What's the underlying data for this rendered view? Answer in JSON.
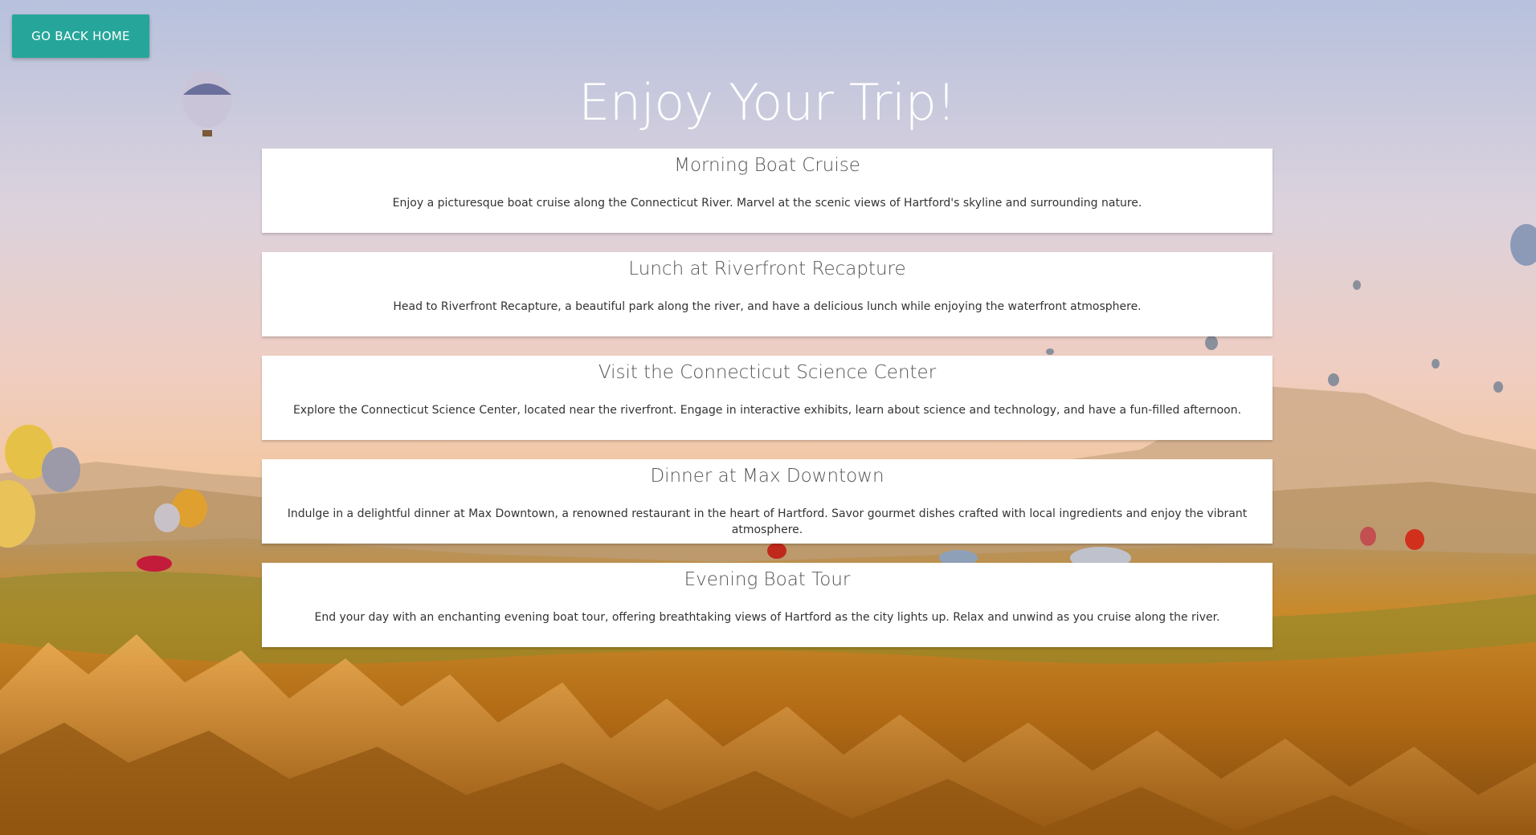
{
  "header": {
    "back_button_label": "GO BACK HOME",
    "title": "Enjoy Your Trip!"
  },
  "background": {
    "description_icon": "hot-air-balloons-landscape",
    "sky_top": "#b9c2dc",
    "sky_mid": "#ecccc6",
    "horizon": "#f3c38a",
    "land": "#b87a1f"
  },
  "theme": {
    "accent": "#26a69a"
  },
  "activities": [
    {
      "title": "Morning Boat Cruise",
      "description": "Enjoy a picturesque boat cruise along the Connecticut River. Marvel at the scenic views of Hartford's skyline and surrounding nature."
    },
    {
      "title": "Lunch at Riverfront Recapture",
      "description": "Head to Riverfront Recapture, a beautiful park along the river, and have a delicious lunch while enjoying the waterfront atmosphere."
    },
    {
      "title": "Visit the Connecticut Science Center",
      "description": "Explore the Connecticut Science Center, located near the riverfront. Engage in interactive exhibits, learn about science and technology, and have a fun-filled afternoon."
    },
    {
      "title": "Dinner at Max Downtown",
      "description": "Indulge in a delightful dinner at Max Downtown, a renowned restaurant in the heart of Hartford. Savor gourmet dishes crafted with local ingredients and enjoy the vibrant atmosphere."
    },
    {
      "title": "Evening Boat Tour",
      "description": "End your day with an enchanting evening boat tour, offering breathtaking views of Hartford as the city lights up. Relax and unwind as you cruise along the river."
    }
  ]
}
